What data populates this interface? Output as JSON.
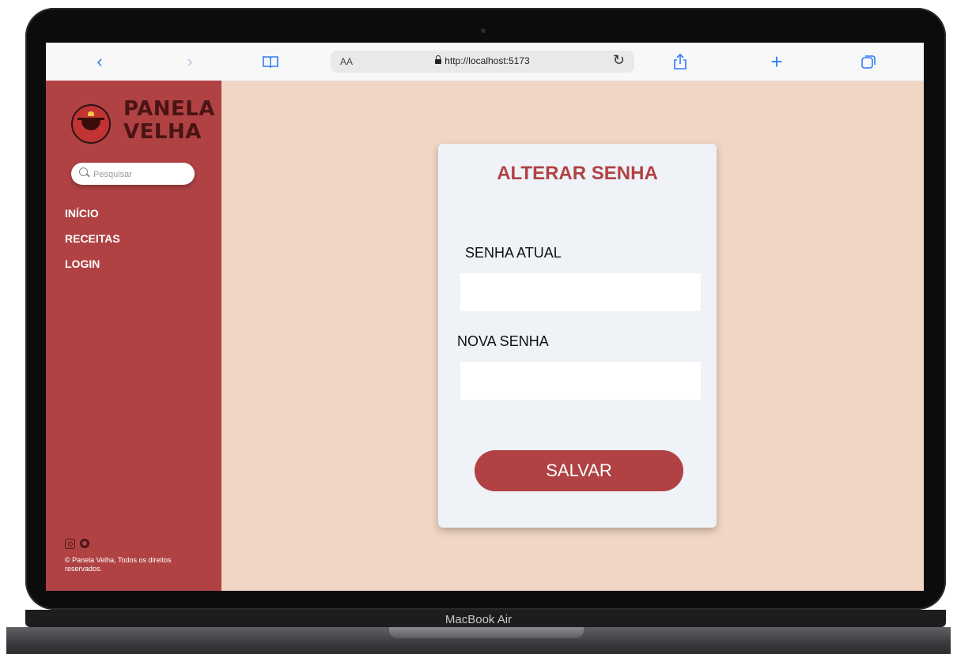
{
  "browser": {
    "text_size_label": "AA",
    "url": "http://localhost:5173",
    "icons": [
      "back-icon",
      "forward-icon",
      "bookmarks-icon",
      "reload-icon",
      "share-icon",
      "new-tab-icon",
      "tabs-icon"
    ]
  },
  "sidebar": {
    "brand_line1": "PANELA",
    "brand_line2": "VELHA",
    "search_placeholder": "Pesquisar",
    "nav": [
      {
        "label": "INÍCIO"
      },
      {
        "label": "RECEITAS"
      },
      {
        "label": "LOGIN"
      }
    ],
    "copyright": "© Panela Velha, Todos os direitos reservados."
  },
  "card": {
    "title": "ALTERAR SENHA",
    "current_password_label": "SENHA ATUAL",
    "new_password_label": "NOVA SENHA",
    "current_password_value": "",
    "new_password_value": "",
    "save_label": "SALVAR"
  },
  "device": {
    "label": "MacBook Air"
  },
  "colors": {
    "accent": "#b04244",
    "page_background": "#f1d6c5",
    "card_background": "#eff2f7",
    "browser_blue": "#2f7bf6"
  }
}
